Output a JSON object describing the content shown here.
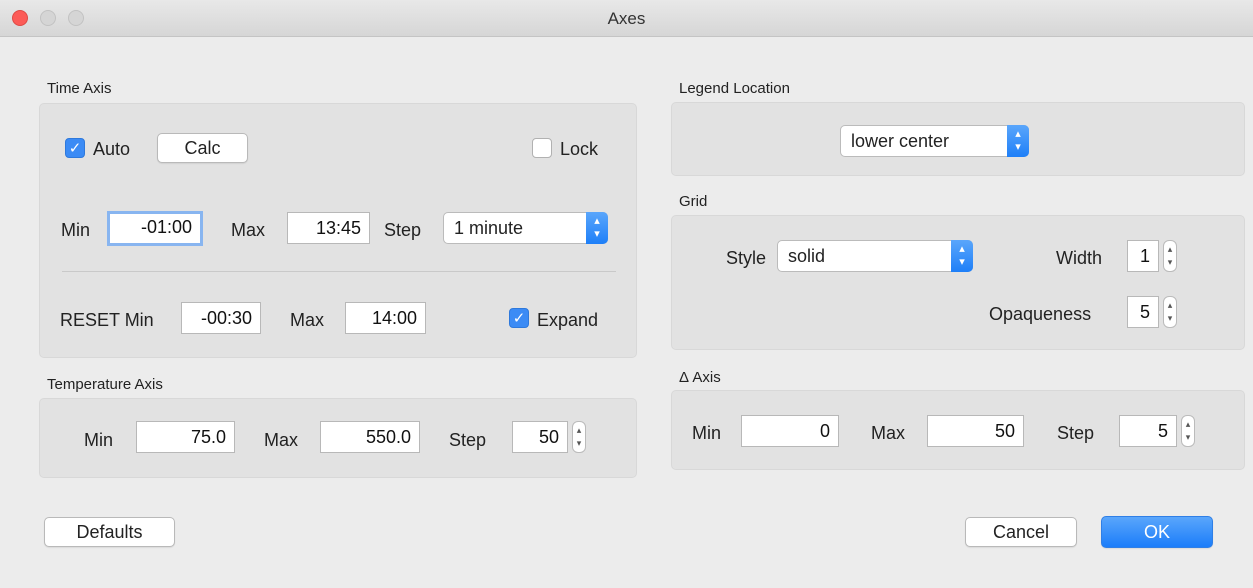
{
  "window": {
    "title": "Axes"
  },
  "time_axis": {
    "section_label": "Time Axis",
    "auto_label": "Auto",
    "auto_checked": true,
    "calc_label": "Calc",
    "lock_label": "Lock",
    "lock_checked": false,
    "min_label": "Min",
    "min_value": "-01:00",
    "max_label": "Max",
    "max_value": "13:45",
    "step_label": "Step",
    "step_value": "1 minute",
    "reset_min_label": "RESET Min",
    "reset_min_value": "-00:30",
    "reset_max_label": "Max",
    "reset_max_value": "14:00",
    "expand_label": "Expand",
    "expand_checked": true
  },
  "temperature_axis": {
    "section_label": "Temperature Axis",
    "min_label": "Min",
    "min_value": "75.0",
    "max_label": "Max",
    "max_value": "550.0",
    "step_label": "Step",
    "step_value": "50"
  },
  "legend": {
    "section_label": "Legend Location",
    "value": "lower center"
  },
  "grid": {
    "section_label": "Grid",
    "style_label": "Style",
    "style_value": "solid",
    "width_label": "Width",
    "width_value": "1",
    "opaqueness_label": "Opaqueness",
    "opaqueness_value": "5"
  },
  "delta_axis": {
    "section_label": "Δ Axis",
    "min_label": "Min",
    "min_value": "0",
    "max_label": "Max",
    "max_value": "50",
    "step_label": "Step",
    "step_value": "5"
  },
  "footer": {
    "defaults_label": "Defaults",
    "cancel_label": "Cancel",
    "ok_label": "OK"
  },
  "icons": {
    "checkmark": "✓",
    "select_arrows": "⌃⌄",
    "stepper_arrows": "⌃⌄"
  },
  "colors": {
    "accent": "#1b7dfa",
    "close": "#fc5b57"
  }
}
